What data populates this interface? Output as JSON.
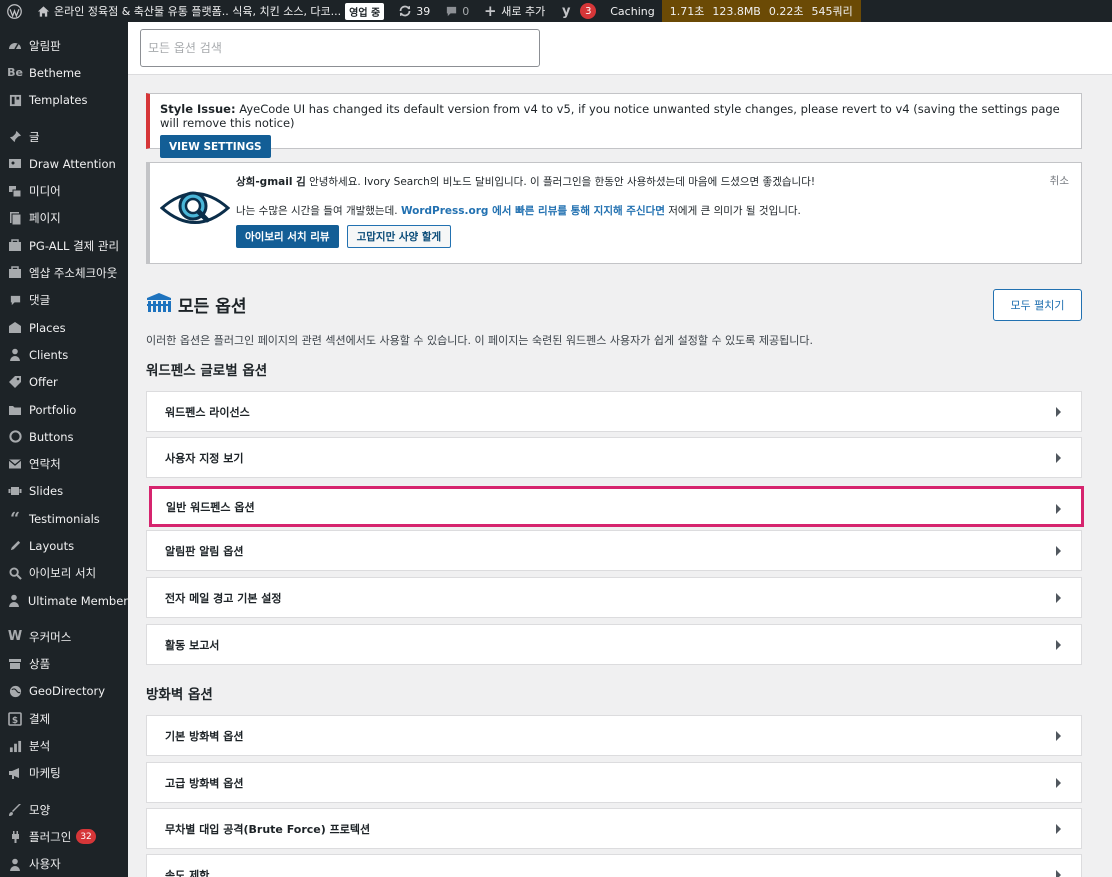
{
  "adminbar": {
    "site_title": "온라인 정육점 & 축산물 유통 플랫폼.. 식육, 치킨 소스, 다코...",
    "open_status": "영업 중",
    "updates_count": "39",
    "comments_count": "0",
    "new_label": "새로 추가",
    "yoast_count": "3",
    "caching_label": "Caching",
    "perf_time": "1.71초",
    "perf_memory": "123.8MB",
    "perf_query_time": "0.22초",
    "perf_queries": "545쿼리"
  },
  "sidebar": {
    "items": [
      {
        "label": "알림판",
        "icon": "dashboard-icon"
      },
      {
        "label": "Betheme",
        "icon": "betheme-icon"
      },
      {
        "label": "Templates",
        "icon": "templates-icon"
      },
      {
        "label": "글",
        "icon": "pin-icon"
      },
      {
        "label": "Draw Attention",
        "icon": "draw-attention-icon"
      },
      {
        "label": "미디어",
        "icon": "media-icon"
      },
      {
        "label": "페이지",
        "icon": "page-icon"
      },
      {
        "label": "PG-ALL 결제 관리",
        "icon": "payment-icon"
      },
      {
        "label": "엠샵 주소체크아웃",
        "icon": "address-icon"
      },
      {
        "label": "댓글",
        "icon": "comment-icon"
      },
      {
        "label": "Places",
        "icon": "places-icon"
      },
      {
        "label": "Clients",
        "icon": "clients-icon"
      },
      {
        "label": "Offer",
        "icon": "offer-icon"
      },
      {
        "label": "Portfolio",
        "icon": "portfolio-icon"
      },
      {
        "label": "Buttons",
        "icon": "buttons-icon"
      },
      {
        "label": "연락처",
        "icon": "mail-icon"
      },
      {
        "label": "Slides",
        "icon": "slides-icon"
      },
      {
        "label": "Testimonials",
        "icon": "quote-icon"
      },
      {
        "label": "Layouts",
        "icon": "layouts-icon"
      },
      {
        "label": "아이보리 서치",
        "icon": "search-icon"
      },
      {
        "label": "Ultimate Member",
        "icon": "user-icon"
      },
      {
        "label": "우커머스",
        "icon": "woocommerce-icon"
      },
      {
        "label": "상품",
        "icon": "products-icon"
      },
      {
        "label": "GeoDirectory",
        "icon": "globe-icon"
      },
      {
        "label": "결제",
        "icon": "payments-icon"
      },
      {
        "label": "분석",
        "icon": "analytics-icon"
      },
      {
        "label": "마케팅",
        "icon": "megaphone-icon"
      },
      {
        "label": "모양",
        "icon": "brush-icon"
      },
      {
        "label": "플러그인",
        "icon": "plugin-icon",
        "badge": "32"
      },
      {
        "label": "사용자",
        "icon": "users-icon"
      }
    ]
  },
  "search": {
    "placeholder": "모든 옵션 검색"
  },
  "style_notice": {
    "title": "Style Issue:",
    "message": " AyeCode UI has changed its default version from v4 to v5, if you notice unwanted style changes, please revert to v4 (saving the settings page will remove this notice)",
    "button": "VIEW SETTINGS"
  },
  "review_notice": {
    "name": "상희-gmail 김",
    "line1": " 안녕하세요. Ivory Search의 비노드 달비입니다. 이 플러그인을 한동안 사용하셨는데 마음에 드셨으면 좋겠습니다!",
    "line2_pre": "나는 수많은 시간을 들여 개발했는데. ",
    "line2_link": "WordPress.org 에서 빠른 리뷰를 통해 지지해 주신다면",
    "line2_post": " 저에게 큰 의미가 될 것입니다.",
    "review_button": "아이보리 서치 리뷰",
    "decline_button": "고맙지만 사양 할게",
    "dismiss": "취소"
  },
  "header": {
    "title": "모든 옵션",
    "expand_button": "모두 펼치기",
    "description": "이러한 옵션은 플러그인 페이지의 관련 섹션에서도 사용할 수 있습니다. 이 페이지는 숙련된 워드펜스 사용자가 쉽게 설정할 수 있도록 제공됩니다."
  },
  "groups": {
    "global_title": "워드펜스 글로벌 옵션",
    "global_options": [
      "워드펜스 라이선스",
      "사용자 지정 보기",
      "일반 워드펜스 옵션",
      "알림판 알림 옵션",
      "전자 메일 경고 기본 설정",
      "활동 보고서"
    ],
    "firewall_title": "방화벽 옵션",
    "firewall_options": [
      "기본 방화벽 옵션",
      "고급 방화벽 옵션",
      "무차별 대입 공격(Brute Force) 프로텍션",
      "속도 제한"
    ]
  },
  "colors": {
    "adminbar_bg": "#1d2327",
    "accent": "#2271b1",
    "highlight_border": "#d6246e",
    "notice_error": "#d63638"
  }
}
